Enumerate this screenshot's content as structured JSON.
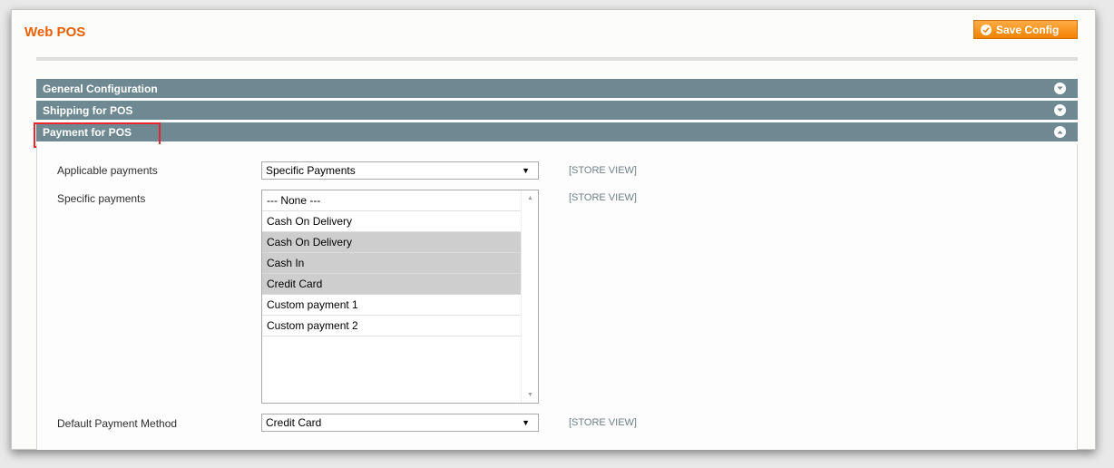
{
  "page": {
    "title": "Web POS",
    "save_button_label": "Save Config"
  },
  "sections": [
    {
      "label": "General Configuration",
      "state": "collapsed",
      "toggle_icon": "chevron-down-circle-icon"
    },
    {
      "label": "Shipping for POS",
      "state": "collapsed",
      "toggle_icon": "chevron-down-circle-icon"
    },
    {
      "label": "Payment for POS",
      "state": "expanded",
      "toggle_icon": "chevron-up-circle-icon"
    }
  ],
  "payment_section": {
    "applicable_payments": {
      "label": "Applicable payments",
      "value": "Specific Payments",
      "scope": "[STORE VIEW]"
    },
    "specific_payments": {
      "label": "Specific payments",
      "scope": "[STORE VIEW]",
      "options": [
        {
          "label": "--- None ---",
          "selected": false
        },
        {
          "label": "Cash On Delivery",
          "selected": false
        },
        {
          "label": "Cash On Delivery",
          "selected": true
        },
        {
          "label": "Cash In",
          "selected": true
        },
        {
          "label": "Credit Card",
          "selected": true
        },
        {
          "label": "Custom payment 1",
          "selected": false
        },
        {
          "label": "Custom payment 2",
          "selected": false
        }
      ]
    },
    "default_payment_method": {
      "label": "Default Payment Method",
      "value": "Credit Card",
      "scope": "[STORE VIEW]"
    }
  },
  "colors": {
    "accent_orange": "#eb5e00",
    "button_orange": "#f18200",
    "section_header": "#6f8992",
    "highlight_red": "#e8262b",
    "selected_option": "#cecece"
  }
}
